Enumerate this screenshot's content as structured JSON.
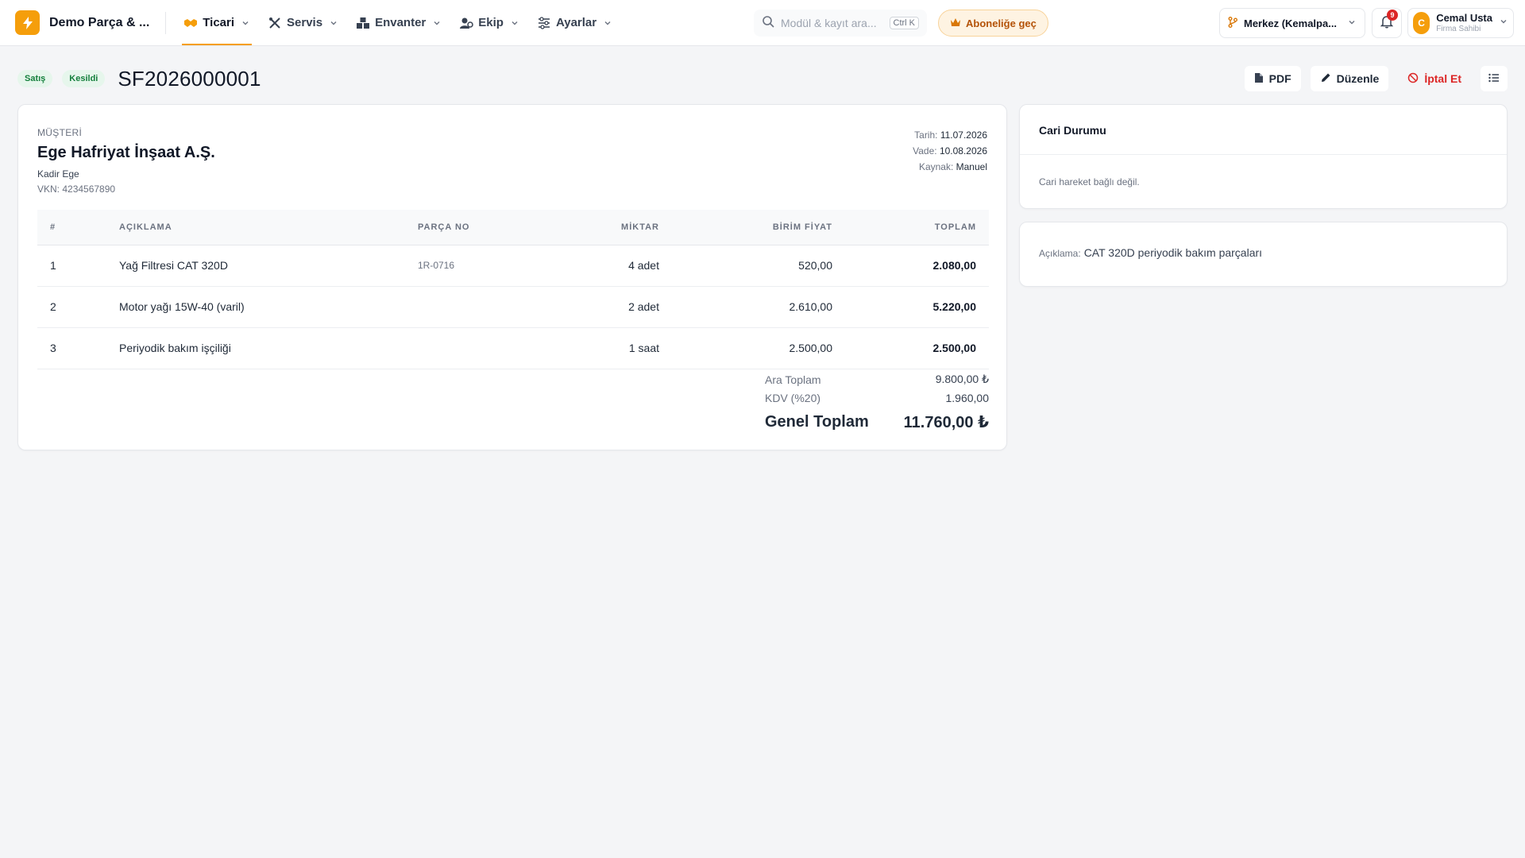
{
  "app": {
    "brand": "Demo Parça & ...",
    "accent": "#f59e0b"
  },
  "nav": {
    "items": [
      {
        "label": "Ticari",
        "icon": "handshake-icon",
        "active": true
      },
      {
        "label": "Servis",
        "icon": "tools-icon",
        "active": false
      },
      {
        "label": "Envanter",
        "icon": "warehouse-icon",
        "active": false
      },
      {
        "label": "Ekip",
        "icon": "team-icon",
        "active": false
      },
      {
        "label": "Ayarlar",
        "icon": "sliders-icon",
        "active": false
      }
    ]
  },
  "search": {
    "placeholder": "Modül & kayıt ara...",
    "shortcut": "Ctrl K"
  },
  "subscribe": {
    "label": "Aboneliğe geç"
  },
  "branch": {
    "label": "Merkez (Kemalpa..."
  },
  "notifications": {
    "count": "9"
  },
  "user": {
    "initial": "C",
    "name": "Cemal Usta",
    "role": "Firma Sahibi"
  },
  "invoice": {
    "type_badge": "Satış",
    "status_badge": "Kesildi",
    "number": "SF2026000001",
    "actions": {
      "pdf": "PDF",
      "edit": "Düzenle",
      "cancel": "İptal Et"
    },
    "customer": {
      "label": "MÜŞTERİ",
      "name": "Ege Hafriyat İnşaat A.Ş.",
      "contact": "Kadir Ege",
      "vkn": "VKN: 4234567890"
    },
    "meta": {
      "date_label": "Tarih:",
      "date": "11.07.2026",
      "due_label": "Vade:",
      "due": "10.08.2026",
      "source_label": "Kaynak:",
      "source": "Manuel"
    },
    "columns": {
      "no": "#",
      "desc": "AÇIKLAMA",
      "part": "PARÇA NO",
      "qty": "MİKTAR",
      "unit": "BİRİM FİYAT",
      "total": "TOPLAM"
    },
    "rows": [
      {
        "no": "1",
        "desc": "Yağ Filtresi CAT 320D",
        "part": "1R-0716",
        "qty": "4 adet",
        "unit": "520,00",
        "total": "2.080,00"
      },
      {
        "no": "2",
        "desc": "Motor yağı 15W-40 (varil)",
        "part": "",
        "qty": "2 adet",
        "unit": "2.610,00",
        "total": "5.220,00"
      },
      {
        "no": "3",
        "desc": "Periyodik bakım işçiliği",
        "part": "",
        "qty": "1 saat",
        "unit": "2.500,00",
        "total": "2.500,00"
      }
    ],
    "totals": {
      "subtotal_label": "Ara Toplam",
      "subtotal": "9.800,00 ₺",
      "vat_label": "KDV (%20)",
      "vat": "1.960,00",
      "grand_label": "Genel Toplam",
      "grand": "11.760,00 ₺"
    }
  },
  "cari": {
    "title": "Cari Durumu",
    "empty": "Cari hareket bağlı değil."
  },
  "note": {
    "label": "Açıklama:",
    "text": "CAT 320D periyodik bakım parçaları"
  }
}
